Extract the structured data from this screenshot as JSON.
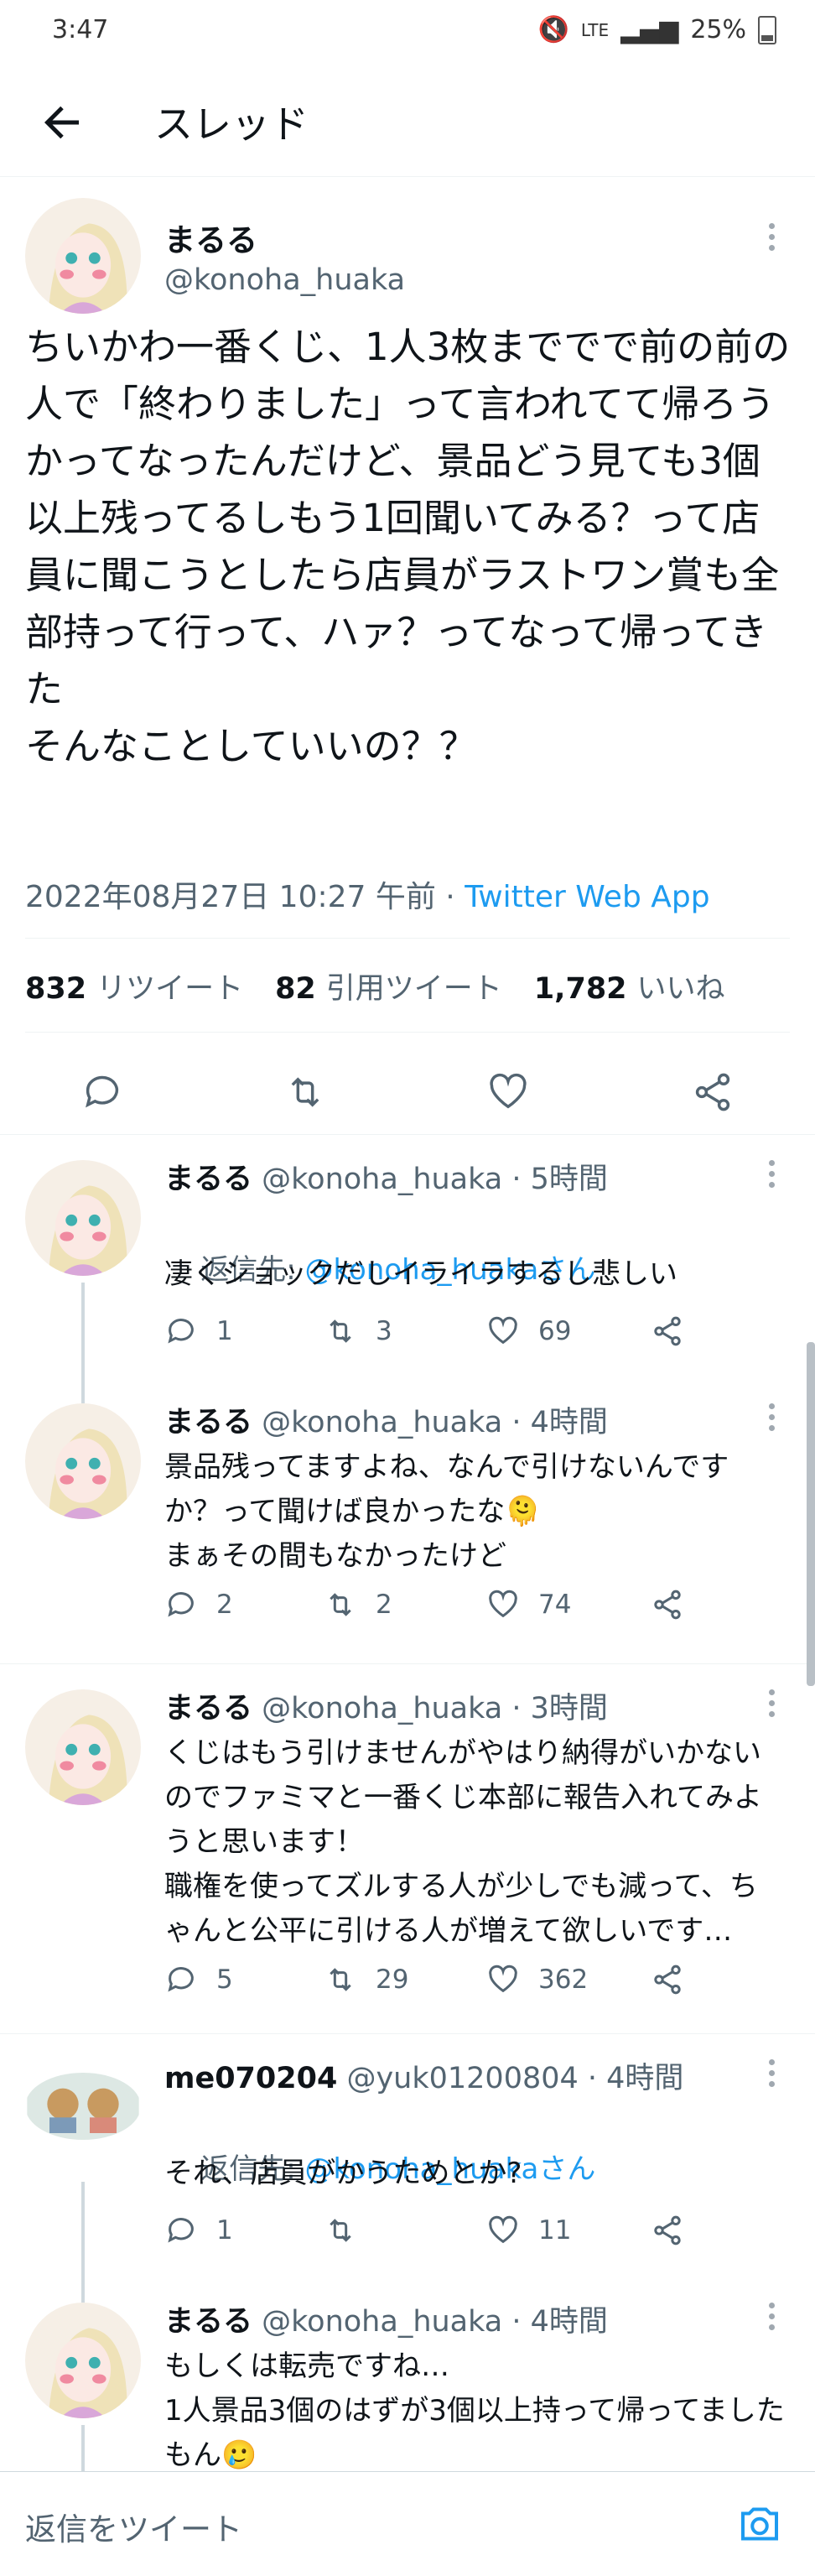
{
  "status": {
    "time": "3:47",
    "network": "LTE",
    "battery": "25%"
  },
  "header": {
    "title": "スレッド"
  },
  "colors": {
    "link": "#1d9bf0",
    "muted": "#536471"
  },
  "main_tweet": {
    "name": "まるる",
    "handle": "@konoha_huaka",
    "text": "ちいかわ一番くじ、1人3枚まででで前の前の人で「終わりました」って言われてて帰ろうかってなったんだけど、景品どう見ても3個以上残ってるしもう1回聞いてみる？って店員に聞こうとしたら店員がラストワン賞も全部持って行って、ハァ？ってなって帰ってきた\nそんなことしていいの？？",
    "timestamp": "2022年08月27日 10:27 午前 · ",
    "source": "Twitter Web App",
    "stats": {
      "retweets": "832",
      "retweets_label": "リツイート",
      "quotes": "82",
      "quotes_label": "引用ツイート",
      "likes": "1,782",
      "likes_label": "いいね"
    }
  },
  "replies": [
    {
      "name": "まるる",
      "handle": "@konoha_huaka",
      "time": " · 5時間",
      "reply_to_prefix": "返信先: ",
      "reply_to_link": "@konoha_huakaさん",
      "text": "凄くショックだしイライラするし悲しい",
      "replies": "1",
      "retweets": "3",
      "likes": "69"
    },
    {
      "name": "まるる",
      "handle": "@konoha_huaka",
      "time": " · 4時間",
      "text": "景品残ってますよね、なんで引けないんですか？って聞けば良かったな🫠\nまぁその間もなかったけど",
      "replies": "2",
      "retweets": "2",
      "likes": "74"
    },
    {
      "name": "まるる",
      "handle": "@konoha_huaka",
      "time": " · 3時間",
      "text": "くじはもう引けませんがやはり納得がいかないのでファミマと一番くじ本部に報告入れてみようと思います！\n職権を使ってズルする人が少しでも減って、ちゃんと公平に引ける人が増えて欲しいです…",
      "replies": "5",
      "retweets": "29",
      "likes": "362"
    },
    {
      "name": "me070204",
      "handle": "@yuk01200804",
      "time": " · 4時間",
      "reply_to_prefix": "返信先: ",
      "reply_to_link": "@konoha_huakaさん",
      "text": "それ、店員がかうためとか?",
      "replies": "1",
      "retweets": "",
      "likes": "11"
    },
    {
      "name": "まるる",
      "handle": "@konoha_huaka",
      "time": " · 4時間",
      "text": "もしくは転売ですね…\n1人景品3個のはずが3個以上持って帰ってましたもん🥲"
    }
  ],
  "compose": {
    "placeholder": "返信をツイート"
  }
}
